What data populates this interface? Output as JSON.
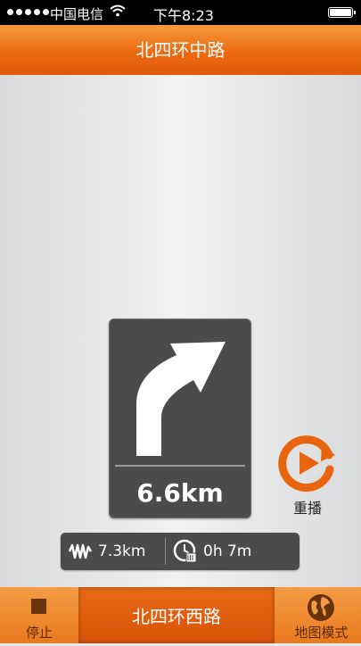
{
  "status": {
    "carrier": "中国电信",
    "time": "下午8:23"
  },
  "header": {
    "title": "北四环中路"
  },
  "turn": {
    "distance": "6.6km",
    "direction": "right-turn-arrow"
  },
  "replay": {
    "label": "重播"
  },
  "info": {
    "remaining_distance": "7.3km",
    "remaining_time": "0h 7m"
  },
  "bottom": {
    "stop_label": "停止",
    "current_road": "北四环西路",
    "map_mode_label": "地图模式"
  },
  "colors": {
    "accent": "#ec6a12",
    "panel": "#4b4b4b"
  }
}
